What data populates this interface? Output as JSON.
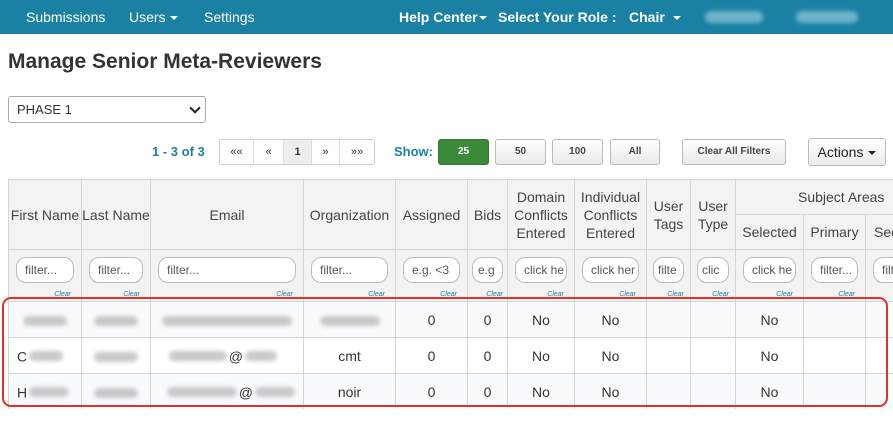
{
  "nav": {
    "submissions": "Submissions",
    "users": "Users",
    "settings": "Settings",
    "help_center": "Help Center",
    "role_label": "Select Your Role :",
    "role_value": "Chair"
  },
  "page": {
    "title": "Manage Senior Meta-Reviewers"
  },
  "phase_select": {
    "value": "PHASE 1"
  },
  "pagination": {
    "range": "1 - 3 of 3",
    "first": "««",
    "prev": "«",
    "current": "1",
    "next": "»",
    "last": "»»"
  },
  "show": {
    "label": "Show:",
    "options": [
      "25",
      "50",
      "100",
      "All"
    ],
    "selected": "25"
  },
  "toolbar": {
    "clear_filters": "Clear All Filters",
    "actions": "Actions"
  },
  "table": {
    "columns": {
      "first_name": "First Name",
      "last_name": "Last Name",
      "email": "Email",
      "organization": "Organization",
      "assigned": "Assigned",
      "bids": "Bids",
      "domain_conflicts": "Domain Conflicts Entered",
      "individual_conflicts": "Individual Conflicts Entered",
      "user_tags": "User Tags",
      "user_type": "User Type",
      "subject_areas": "Subject Areas",
      "selected": "Selected",
      "primary": "Primary",
      "secondary": "Sec"
    },
    "filters": {
      "first_name": "filter...",
      "last_name": "filter...",
      "email": "filter...",
      "organization": "filter...",
      "assigned": "e.g. <3",
      "bids": "e.g",
      "domain_conflicts": "click he",
      "individual_conflicts": "click her",
      "user_tags": "filte",
      "user_type": "clic",
      "selected": "click he",
      "primary": "filter...",
      "secondary": "filt",
      "clear": "Clear"
    },
    "rows": [
      {
        "first": "",
        "last": "",
        "email": "",
        "org": "",
        "assigned": "0",
        "bids": "0",
        "domain": "No",
        "individual": "No",
        "tags": "",
        "type": "",
        "selected": "No",
        "primary": ""
      },
      {
        "first": "C",
        "last": "",
        "email": "@",
        "org": "cmt",
        "assigned": "0",
        "bids": "0",
        "domain": "No",
        "individual": "No",
        "tags": "",
        "type": "",
        "selected": "No",
        "primary": ""
      },
      {
        "first": "H",
        "last": "",
        "email": "@",
        "org": "noir",
        "assigned": "0",
        "bids": "0",
        "domain": "No",
        "individual": "No",
        "tags": "",
        "type": "",
        "selected": "No",
        "primary": ""
      }
    ]
  }
}
